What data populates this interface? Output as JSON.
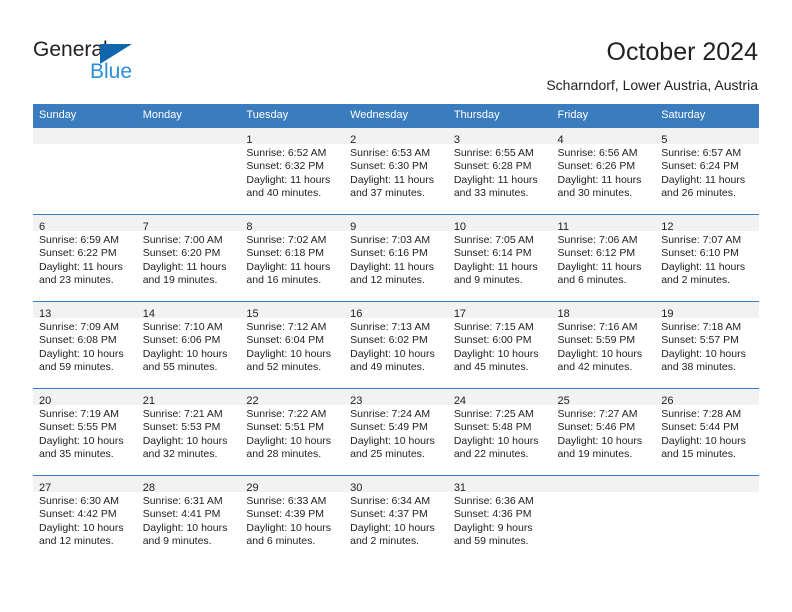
{
  "brand": {
    "name_part1": "General",
    "name_part2": "Blue"
  },
  "header": {
    "title": "October 2024",
    "location": "Scharndorf, Lower Austria, Austria"
  },
  "calendar": {
    "weekday_headers": [
      "Sunday",
      "Monday",
      "Tuesday",
      "Wednesday",
      "Thursday",
      "Friday",
      "Saturday"
    ],
    "colors": {
      "header_background": "#3a7cbe",
      "header_text": "#ffffff",
      "daynum_band": "#f2f2f2",
      "grid_line": "#3a7cbe",
      "brand_blue": "#2b8fd8",
      "logo_triangle": "#1066ac"
    },
    "weeks": [
      [
        {
          "day": "",
          "sunrise": "",
          "sunset": "",
          "daylight_line1": "",
          "daylight_line2": ""
        },
        {
          "day": "",
          "sunrise": "",
          "sunset": "",
          "daylight_line1": "",
          "daylight_line2": ""
        },
        {
          "day": "1",
          "sunrise": "Sunrise: 6:52 AM",
          "sunset": "Sunset: 6:32 PM",
          "daylight_line1": "Daylight: 11 hours",
          "daylight_line2": "and 40 minutes."
        },
        {
          "day": "2",
          "sunrise": "Sunrise: 6:53 AM",
          "sunset": "Sunset: 6:30 PM",
          "daylight_line1": "Daylight: 11 hours",
          "daylight_line2": "and 37 minutes."
        },
        {
          "day": "3",
          "sunrise": "Sunrise: 6:55 AM",
          "sunset": "Sunset: 6:28 PM",
          "daylight_line1": "Daylight: 11 hours",
          "daylight_line2": "and 33 minutes."
        },
        {
          "day": "4",
          "sunrise": "Sunrise: 6:56 AM",
          "sunset": "Sunset: 6:26 PM",
          "daylight_line1": "Daylight: 11 hours",
          "daylight_line2": "and 30 minutes."
        },
        {
          "day": "5",
          "sunrise": "Sunrise: 6:57 AM",
          "sunset": "Sunset: 6:24 PM",
          "daylight_line1": "Daylight: 11 hours",
          "daylight_line2": "and 26 minutes."
        }
      ],
      [
        {
          "day": "6",
          "sunrise": "Sunrise: 6:59 AM",
          "sunset": "Sunset: 6:22 PM",
          "daylight_line1": "Daylight: 11 hours",
          "daylight_line2": "and 23 minutes."
        },
        {
          "day": "7",
          "sunrise": "Sunrise: 7:00 AM",
          "sunset": "Sunset: 6:20 PM",
          "daylight_line1": "Daylight: 11 hours",
          "daylight_line2": "and 19 minutes."
        },
        {
          "day": "8",
          "sunrise": "Sunrise: 7:02 AM",
          "sunset": "Sunset: 6:18 PM",
          "daylight_line1": "Daylight: 11 hours",
          "daylight_line2": "and 16 minutes."
        },
        {
          "day": "9",
          "sunrise": "Sunrise: 7:03 AM",
          "sunset": "Sunset: 6:16 PM",
          "daylight_line1": "Daylight: 11 hours",
          "daylight_line2": "and 12 minutes."
        },
        {
          "day": "10",
          "sunrise": "Sunrise: 7:05 AM",
          "sunset": "Sunset: 6:14 PM",
          "daylight_line1": "Daylight: 11 hours",
          "daylight_line2": "and 9 minutes."
        },
        {
          "day": "11",
          "sunrise": "Sunrise: 7:06 AM",
          "sunset": "Sunset: 6:12 PM",
          "daylight_line1": "Daylight: 11 hours",
          "daylight_line2": "and 6 minutes."
        },
        {
          "day": "12",
          "sunrise": "Sunrise: 7:07 AM",
          "sunset": "Sunset: 6:10 PM",
          "daylight_line1": "Daylight: 11 hours",
          "daylight_line2": "and 2 minutes."
        }
      ],
      [
        {
          "day": "13",
          "sunrise": "Sunrise: 7:09 AM",
          "sunset": "Sunset: 6:08 PM",
          "daylight_line1": "Daylight: 10 hours",
          "daylight_line2": "and 59 minutes."
        },
        {
          "day": "14",
          "sunrise": "Sunrise: 7:10 AM",
          "sunset": "Sunset: 6:06 PM",
          "daylight_line1": "Daylight: 10 hours",
          "daylight_line2": "and 55 minutes."
        },
        {
          "day": "15",
          "sunrise": "Sunrise: 7:12 AM",
          "sunset": "Sunset: 6:04 PM",
          "daylight_line1": "Daylight: 10 hours",
          "daylight_line2": "and 52 minutes."
        },
        {
          "day": "16",
          "sunrise": "Sunrise: 7:13 AM",
          "sunset": "Sunset: 6:02 PM",
          "daylight_line1": "Daylight: 10 hours",
          "daylight_line2": "and 49 minutes."
        },
        {
          "day": "17",
          "sunrise": "Sunrise: 7:15 AM",
          "sunset": "Sunset: 6:00 PM",
          "daylight_line1": "Daylight: 10 hours",
          "daylight_line2": "and 45 minutes."
        },
        {
          "day": "18",
          "sunrise": "Sunrise: 7:16 AM",
          "sunset": "Sunset: 5:59 PM",
          "daylight_line1": "Daylight: 10 hours",
          "daylight_line2": "and 42 minutes."
        },
        {
          "day": "19",
          "sunrise": "Sunrise: 7:18 AM",
          "sunset": "Sunset: 5:57 PM",
          "daylight_line1": "Daylight: 10 hours",
          "daylight_line2": "and 38 minutes."
        }
      ],
      [
        {
          "day": "20",
          "sunrise": "Sunrise: 7:19 AM",
          "sunset": "Sunset: 5:55 PM",
          "daylight_line1": "Daylight: 10 hours",
          "daylight_line2": "and 35 minutes."
        },
        {
          "day": "21",
          "sunrise": "Sunrise: 7:21 AM",
          "sunset": "Sunset: 5:53 PM",
          "daylight_line1": "Daylight: 10 hours",
          "daylight_line2": "and 32 minutes."
        },
        {
          "day": "22",
          "sunrise": "Sunrise: 7:22 AM",
          "sunset": "Sunset: 5:51 PM",
          "daylight_line1": "Daylight: 10 hours",
          "daylight_line2": "and 28 minutes."
        },
        {
          "day": "23",
          "sunrise": "Sunrise: 7:24 AM",
          "sunset": "Sunset: 5:49 PM",
          "daylight_line1": "Daylight: 10 hours",
          "daylight_line2": "and 25 minutes."
        },
        {
          "day": "24",
          "sunrise": "Sunrise: 7:25 AM",
          "sunset": "Sunset: 5:48 PM",
          "daylight_line1": "Daylight: 10 hours",
          "daylight_line2": "and 22 minutes."
        },
        {
          "day": "25",
          "sunrise": "Sunrise: 7:27 AM",
          "sunset": "Sunset: 5:46 PM",
          "daylight_line1": "Daylight: 10 hours",
          "daylight_line2": "and 19 minutes."
        },
        {
          "day": "26",
          "sunrise": "Sunrise: 7:28 AM",
          "sunset": "Sunset: 5:44 PM",
          "daylight_line1": "Daylight: 10 hours",
          "daylight_line2": "and 15 minutes."
        }
      ],
      [
        {
          "day": "27",
          "sunrise": "Sunrise: 6:30 AM",
          "sunset": "Sunset: 4:42 PM",
          "daylight_line1": "Daylight: 10 hours",
          "daylight_line2": "and 12 minutes."
        },
        {
          "day": "28",
          "sunrise": "Sunrise: 6:31 AM",
          "sunset": "Sunset: 4:41 PM",
          "daylight_line1": "Daylight: 10 hours",
          "daylight_line2": "and 9 minutes."
        },
        {
          "day": "29",
          "sunrise": "Sunrise: 6:33 AM",
          "sunset": "Sunset: 4:39 PM",
          "daylight_line1": "Daylight: 10 hours",
          "daylight_line2": "and 6 minutes."
        },
        {
          "day": "30",
          "sunrise": "Sunrise: 6:34 AM",
          "sunset": "Sunset: 4:37 PM",
          "daylight_line1": "Daylight: 10 hours",
          "daylight_line2": "and 2 minutes."
        },
        {
          "day": "31",
          "sunrise": "Sunrise: 6:36 AM",
          "sunset": "Sunset: 4:36 PM",
          "daylight_line1": "Daylight: 9 hours",
          "daylight_line2": "and 59 minutes."
        },
        {
          "day": "",
          "sunrise": "",
          "sunset": "",
          "daylight_line1": "",
          "daylight_line2": ""
        },
        {
          "day": "",
          "sunrise": "",
          "sunset": "",
          "daylight_line1": "",
          "daylight_line2": ""
        }
      ]
    ]
  }
}
